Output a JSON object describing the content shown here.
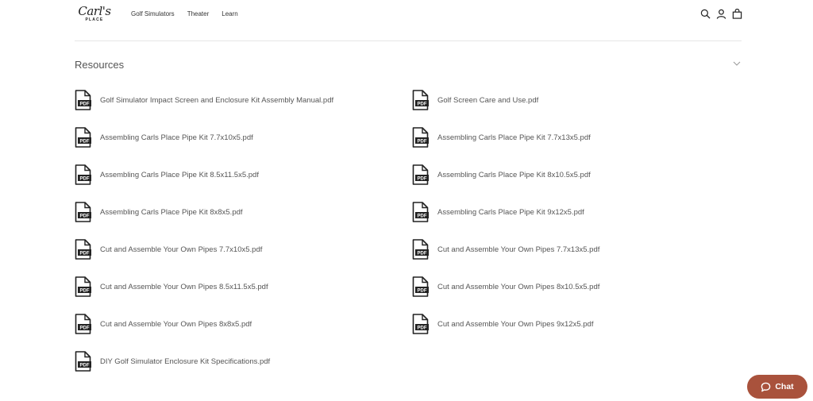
{
  "header": {
    "logo": {
      "script": "Carl's",
      "sub": "PLACE"
    },
    "nav": [
      {
        "label": "Golf Simulators"
      },
      {
        "label": "Theater"
      },
      {
        "label": "Learn"
      }
    ],
    "icons": [
      "search-icon",
      "account-icon",
      "cart-icon"
    ]
  },
  "resources": {
    "title": "Resources",
    "expanded": true,
    "files": [
      {
        "name": "Golf Simulator Impact Screen and Enclosure Kit Assembly Manual.pdf",
        "icon": "pdf-icon"
      },
      {
        "name": "Golf Screen Care and Use.pdf",
        "icon": "pdf-icon"
      },
      {
        "name": "Assembling Carls Place Pipe Kit 7.7x10x5.pdf",
        "icon": "pdf-icon"
      },
      {
        "name": "Assembling Carls Place Pipe Kit 7.7x13x5.pdf",
        "icon": "pdf-icon"
      },
      {
        "name": "Assembling Carls Place Pipe Kit 8.5x11.5x5.pdf",
        "icon": "pdf-icon"
      },
      {
        "name": "Assembling Carls Place Pipe Kit 8x10.5x5.pdf",
        "icon": "pdf-icon"
      },
      {
        "name": "Assembling Carls Place Pipe Kit 8x8x5.pdf",
        "icon": "pdf-icon"
      },
      {
        "name": "Assembling Carls Place Pipe Kit 9x12x5.pdf",
        "icon": "pdf-icon"
      },
      {
        "name": "Cut and Assemble Your Own Pipes 7.7x10x5.pdf",
        "icon": "pdf-icon"
      },
      {
        "name": "Cut and Assemble Your Own Pipes 7.7x13x5.pdf",
        "icon": "pdf-icon"
      },
      {
        "name": "Cut and Assemble Your Own Pipes 8.5x11.5x5.pdf",
        "icon": "pdf-icon"
      },
      {
        "name": "Cut and Assemble Your Own Pipes 8x10.5x5.pdf",
        "icon": "pdf-icon"
      },
      {
        "name": "Cut and Assemble Your Own Pipes 8x8x5.pdf",
        "icon": "pdf-icon"
      },
      {
        "name": "Cut and Assemble Your Own Pipes 9x12x5.pdf",
        "icon": "pdf-icon"
      },
      {
        "name": "DIY Golf Simulator Enclosure Kit Specifications.pdf",
        "icon": "pdf-icon"
      }
    ]
  },
  "chat": {
    "label": "Chat",
    "color": "#a9523c"
  },
  "pdf_badge_text": "PDF"
}
